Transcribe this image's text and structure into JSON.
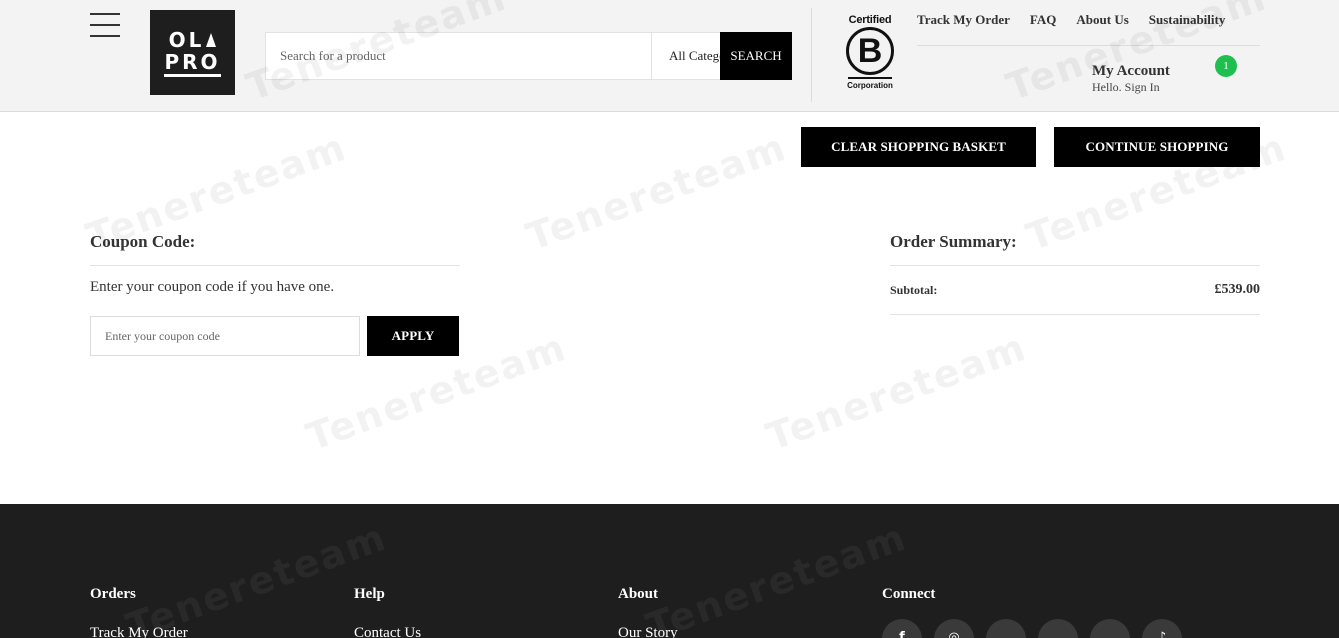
{
  "header": {
    "logo": {
      "line1": "OL",
      "line2": "PRO"
    },
    "search": {
      "placeholder": "Search for a product",
      "category": "All Categories",
      "button_label": "SEARCH"
    },
    "certification": {
      "top": "Certified",
      "letter": "B",
      "bottom": "Corporation"
    },
    "top_links": [
      "Track My Order",
      "FAQ",
      "About Us",
      "Sustainability"
    ],
    "account": {
      "title": "My Account",
      "subtitle": "Hello. Sign In"
    },
    "cart_count": "1"
  },
  "basket_actions": {
    "clear_label": "CLEAR SHOPPING BASKET",
    "continue_label": "CONTINUE SHOPPING"
  },
  "coupon": {
    "title": "Coupon Code:",
    "description": "Enter your coupon code if you have one.",
    "placeholder": "Enter your coupon code",
    "apply_label": "APPLY"
  },
  "summary": {
    "title": "Order Summary:",
    "subtotal_label": "Subtotal:",
    "subtotal_value": "£539.00"
  },
  "footer": {
    "columns": [
      {
        "heading": "Orders",
        "first_link": "Track My Order"
      },
      {
        "heading": "Help",
        "first_link": "Contact Us"
      },
      {
        "heading": "About",
        "first_link": "Our Story"
      },
      {
        "heading": "Connect"
      }
    ],
    "social_icons": [
      "facebook-icon",
      "instagram-icon",
      "twitter-icon",
      "youtube-icon",
      "pinterest-icon",
      "tiktok-icon"
    ]
  },
  "watermark": {
    "text": "Tenereteam"
  },
  "colors": {
    "accent_black": "#000000",
    "badge_green": "#1fbf4f",
    "footer_bg": "#1e1e1e",
    "header_bg": "#f3f3f3"
  }
}
